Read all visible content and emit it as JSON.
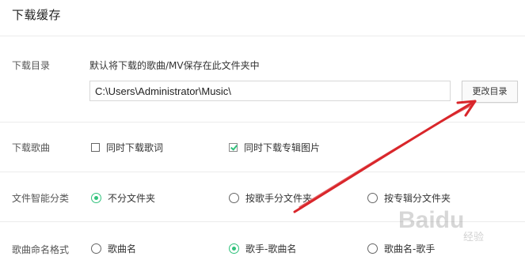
{
  "section": {
    "title": "下载缓存"
  },
  "download_dir": {
    "label": "下载目录",
    "description": "默认将下载的歌曲/MV保存在此文件夹中",
    "path_value": "C:\\Users\\Administrator\\Music\\",
    "change_button": "更改目录"
  },
  "download_songs": {
    "label": "下载歌曲",
    "options": [
      {
        "label": "同时下载歌词",
        "checked": false
      },
      {
        "label": "同时下载专辑图片",
        "checked": true
      }
    ]
  },
  "smart_sort": {
    "label": "文件智能分类",
    "options": [
      {
        "label": "不分文件夹",
        "selected": true
      },
      {
        "label": "按歌手分文件夹",
        "selected": false
      },
      {
        "label": "按专辑分文件夹",
        "selected": false
      }
    ]
  },
  "naming": {
    "label": "歌曲命名格式",
    "options": [
      {
        "label": "歌曲名",
        "selected": false
      },
      {
        "label": "歌手-歌曲名",
        "selected": true
      },
      {
        "label": "歌曲名-歌手",
        "selected": false
      }
    ]
  },
  "watermark": {
    "brand": "Baidu",
    "sub": "经验"
  },
  "colors": {
    "accent": "#31c27c",
    "annotation_arrow": "#d9262b"
  }
}
